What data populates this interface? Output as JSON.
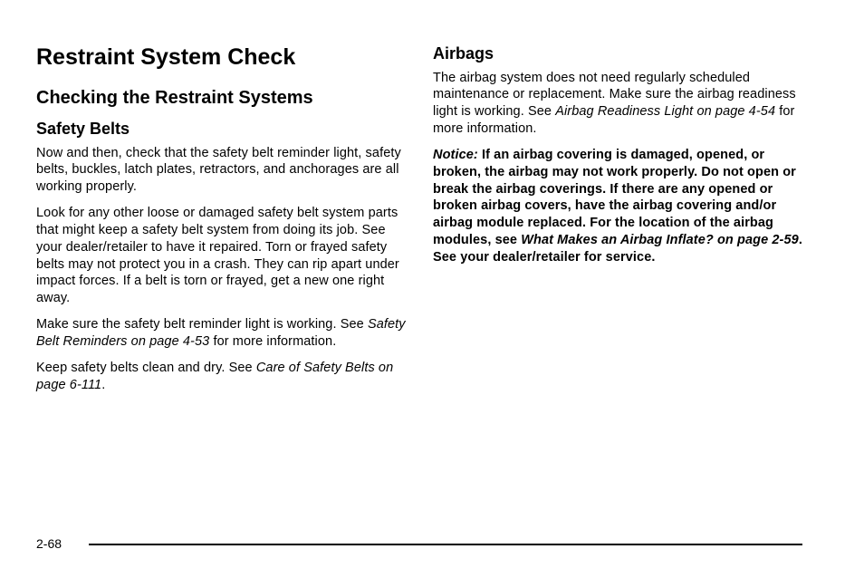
{
  "left": {
    "h1": "Restraint System Check",
    "h2": "Checking the Restraint Systems",
    "h3": "Safety Belts",
    "p1": "Now and then, check that the safety belt reminder light, safety belts, buckles, latch plates, retractors, and anchorages are all working properly.",
    "p2": "Look for any other loose or damaged safety belt system parts that might keep a safety belt system from doing its job. See your dealer/retailer to have it repaired. Torn or frayed safety belts may not protect you in a crash. They can rip apart under impact forces. If a belt is torn or frayed, get a new one right away.",
    "p3a": "Make sure the safety belt reminder light is working. See ",
    "p3_ref": "Safety Belt Reminders on page 4-53",
    "p3b": " for more information.",
    "p4a": "Keep safety belts clean and dry. See ",
    "p4_ref": "Care of Safety Belts on page 6-111",
    "p4b": "."
  },
  "right": {
    "h3": "Airbags",
    "p1a": "The airbag system does not need regularly scheduled maintenance or replacement. Make sure the airbag readiness light is working. See ",
    "p1_ref": "Airbag Readiness Light on page 4-54",
    "p1b": " for more information.",
    "notice_label": "Notice:",
    "notice_a": "If an airbag covering is damaged, opened, or broken, the airbag may not work properly. Do not open or break the airbag coverings. If there are any opened or broken airbag covers, have the airbag covering and/or airbag module replaced. For the location of the airbag modules, see ",
    "notice_ref": "What Makes an Airbag Inflate? on page 2-59",
    "notice_b": ". See your dealer/retailer for service."
  },
  "page_number": "2-68"
}
